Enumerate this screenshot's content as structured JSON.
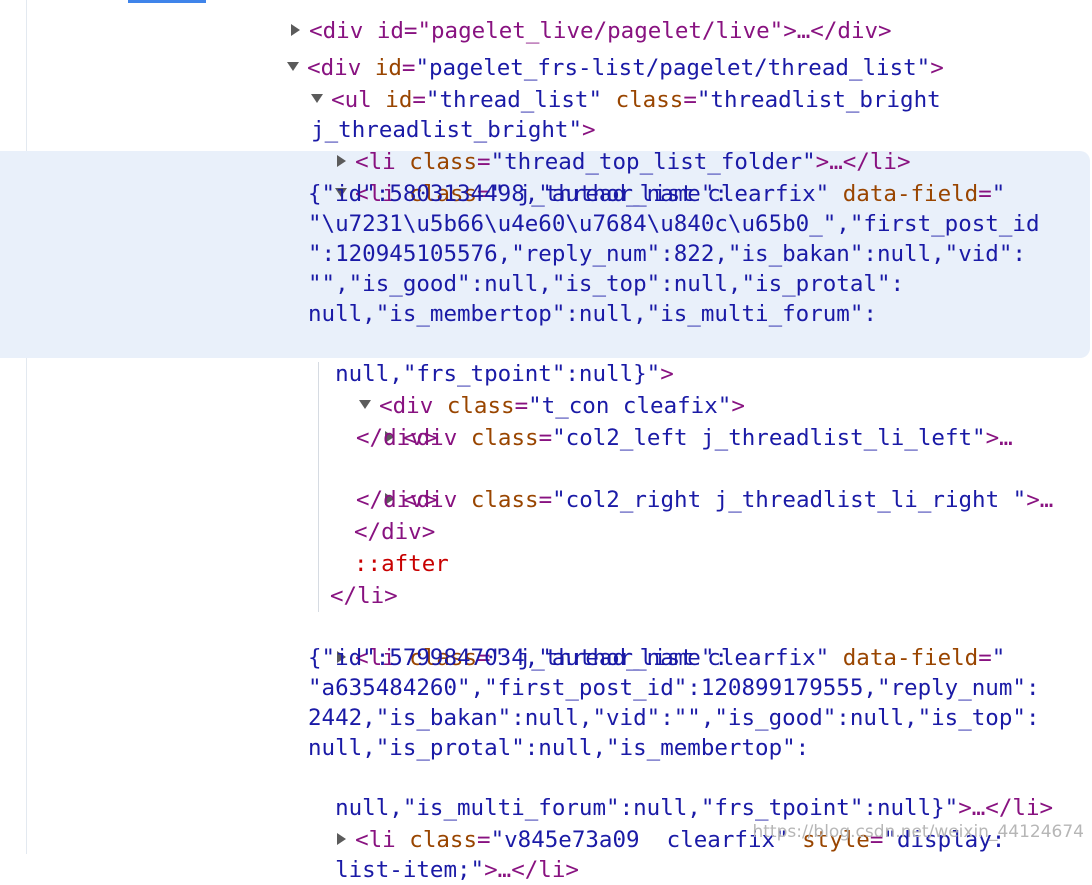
{
  "lines": {
    "l0": {
      "tag": "<div id=\"pagelet_live/pagelet/live\">…</div>"
    },
    "l1": {
      "open": "<div",
      "attr": " id",
      "eq": "=",
      "val": "\"pagelet_frs-list/pagelet/thread_list\"",
      "close": ">"
    },
    "l2": {
      "open": "<ul",
      "attr1": " id",
      "eq1": "=",
      "val1": "\"thread_list\"",
      "attr2": " class",
      "eq2": "=",
      "val2": "\"threadlist_bright",
      "cont": "j_threadlist_bright\"",
      "close": ">"
    },
    "l3": {
      "open": "<li",
      "attr": " class",
      "eq": "=",
      "val": "\"thread_top_list_folder\"",
      "close": ">…</li>"
    },
    "l4": {
      "open": "<li",
      "attr1": " class",
      "eq1": "=",
      "val1": "\" j_thread_list clearfix\"",
      "attr2": " data-field",
      "eq2": "=",
      "q": "\"",
      "d1": "{\"id\":5803134498,\"author_name\":",
      "d2": "\"\\u7231\\u5b66\\u4e60\\u7684\\u840c\\u65b0_\",\"first_post_id",
      "d3": "\":120945105576,\"reply_num\":822,\"is_bakan\":null,\"vid\":",
      "d4": "\"\",\"is_good\":null,\"is_top\":null,\"is_protal\":",
      "d5": "null,\"is_membertop\":null,\"is_multi_forum\":",
      "d6": "null,\"frs_tpoint\":null}\"",
      "close": ">"
    },
    "l5": {
      "open": "<div",
      "attr": " class",
      "eq": "=",
      "val": "\"t_con cleafix\"",
      "close": ">"
    },
    "l6": {
      "open": "<div",
      "attr": " class",
      "eq": "=",
      "val": "\"col2_left j_threadlist_li_left\"",
      "close": ">…",
      "end": "</div>"
    },
    "l7": {
      "open": "<div",
      "attr": " class",
      "eq": "=",
      "val": "\"col2_right j_threadlist_li_right \"",
      "close": ">…",
      "end": "</div>"
    },
    "l8": {
      "end_div": "</div>",
      "pseudo": "::after",
      "end_li": "</li>"
    },
    "l9": {
      "open": "<li",
      "attr1": " class",
      "eq1": "=",
      "val1": "\" j_thread_list clearfix\"",
      "attr2": " data-field",
      "eq2": "=",
      "q": "\"",
      "d1": "{\"id\":5799847034,\"author_name\":",
      "d2": "\"a635484260\",\"first_post_id\":120899179555,\"reply_num\":",
      "d3": "2442,\"is_bakan\":null,\"vid\":\"\",\"is_good\":null,\"is_top\":",
      "d4": "null,\"is_protal\":null,\"is_membertop\":",
      "d5": "null,\"is_multi_forum\":null,\"frs_tpoint\":null}\"",
      "close": ">…</li>"
    },
    "l10": {
      "open": "<li",
      "attr1": " class",
      "eq1": "=",
      "val1": "\"v845e73a09  clearfix\"",
      "attr2": " style",
      "eq2": "=",
      "val2": "\"display:",
      "cont": "list-item;\"",
      "close": ">…</li>"
    }
  },
  "watermark": "https://blog.csdn.net/weixin_44124674",
  "colors": {
    "tag": "#881280",
    "attribute": "#994500",
    "value": "#1a1aa6",
    "selection": "#e9f0fa",
    "pseudo": "#c80000"
  }
}
